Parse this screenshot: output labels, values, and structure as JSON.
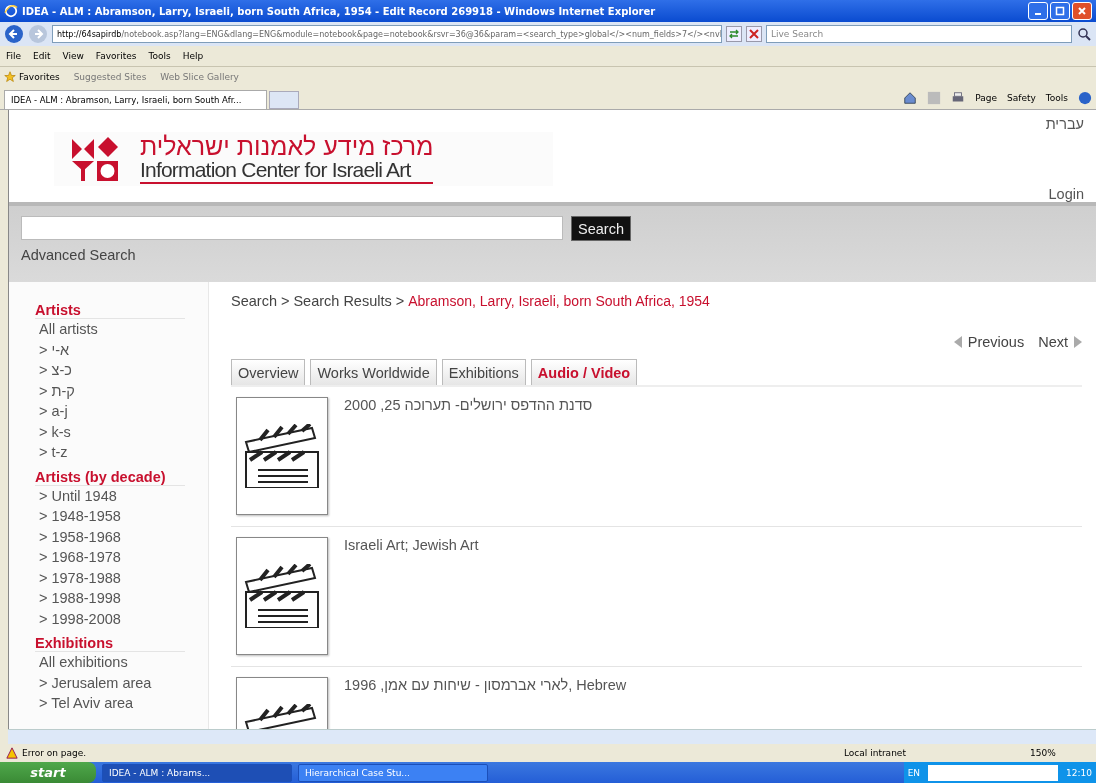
{
  "window": {
    "title": "IDEA - ALM : Abramson, Larry, Israeli, born South Africa, 1954 - Edit Record 269918 - Windows Internet Explorer"
  },
  "address_bar": {
    "host": "http://64sapirdb",
    "path": "/notebook.asp?lang=ENG&dlang=ENG&module=notebook&page=notebook&rsvr=36@36&param=<search_type>global</><num_fields>7</><nvl",
    "search_placeholder": "Live Search"
  },
  "menu": [
    "File",
    "Edit",
    "View",
    "Favorites",
    "Tools",
    "Help"
  ],
  "favorites_bar": {
    "label": "Favorites",
    "items": [
      "Suggested Sites",
      "Web Slice Gallery"
    ]
  },
  "browser_tabs": [
    {
      "label": "IDEA - ALM : Abramson, Larry, Israeli, born South Afr...",
      "selected": true
    }
  ],
  "command_bar": [
    "Page",
    "Safety",
    "Tools"
  ],
  "page": {
    "language_link": "עברית",
    "logo": {
      "hebrew": "מרכז מידע לאמנות ישראלית",
      "english": "Information Center for Israeli Art"
    },
    "login": "Login",
    "search": {
      "button": "Search",
      "advanced": "Advanced Search"
    },
    "sidebar": [
      {
        "heading": "Artists",
        "items": [
          "All artists",
          "> א-י",
          "> כ-צ",
          "> ק-ת",
          "> a-j",
          "> k-s",
          "> t-z"
        ]
      },
      {
        "heading": "Artists (by decade)",
        "items": [
          "> Until 1948",
          "> 1948-1958",
          "> 1958-1968",
          "> 1968-1978",
          "> 1978-1988",
          "> 1988-1998",
          "> 1998-2008"
        ]
      },
      {
        "heading": "Exhibitions",
        "items": [
          "All exhibitions",
          "> Jerusalem area",
          "> Tel Aviv area"
        ]
      }
    ],
    "breadcrumb": [
      {
        "text": "Search",
        "kind": "link"
      },
      {
        "text": ">",
        "kind": "separator"
      },
      {
        "text": "Search Results",
        "kind": "link"
      },
      {
        "text": ">",
        "kind": "separator"
      },
      {
        "text": "Abramson, Larry, Israeli, born South Africa, 1954",
        "kind": "current"
      }
    ],
    "pager": {
      "previous": "Previous",
      "next": "Next"
    },
    "tabs": [
      {
        "label": "Overview",
        "selected": false
      },
      {
        "label": "Works Worldwide",
        "selected": false
      },
      {
        "label": "Exhibitions",
        "selected": false
      },
      {
        "label": "Audio / Video",
        "selected": true
      }
    ],
    "results": [
      {
        "title": "סדנת ההדפס ירושלים- תערוכה 25, 2000"
      },
      {
        "title": "Israeli Art; Jewish Art"
      },
      {
        "title": "לארי אברמסון - שיחות עם אמן, 1996, Hebrew"
      }
    ]
  },
  "status_bar": {
    "message": "Error on page.",
    "zone": "Local intranet",
    "zoom": "150%"
  },
  "taskbar": {
    "start": "start",
    "tasks": [
      {
        "label": "IDEA - ALM : Abrams...",
        "selected": true
      },
      {
        "label": "Hierarchical Case Stu...",
        "selected": false
      }
    ],
    "language": "EN",
    "clock": "12:10"
  }
}
